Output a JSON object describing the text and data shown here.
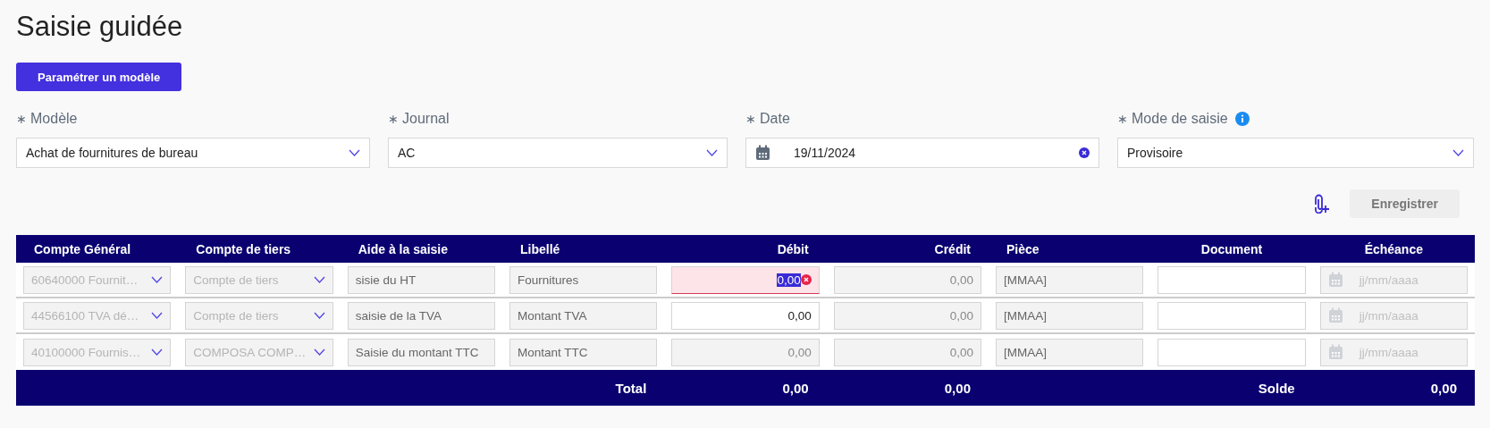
{
  "title": "Saisie guidée",
  "setup_button": "Paramétrer un modèle",
  "fields": [
    {
      "kind": "select",
      "required_mark": "∗",
      "label": "Modèle",
      "value": "Achat de fournitures de bureau"
    },
    {
      "kind": "select",
      "required_mark": "∗",
      "label": "Journal",
      "value": "AC"
    },
    {
      "kind": "date",
      "required_mark": "∗",
      "label": "Date",
      "value": "19/11/2024"
    },
    {
      "kind": "select",
      "required_mark": "∗",
      "label": "Mode de saisie",
      "value": "Provisoire",
      "info": true
    }
  ],
  "save_button": {
    "label": "Enregistrer",
    "disabled": true
  },
  "table": {
    "columns": [
      "Compte Général",
      "Compte de tiers",
      "Aide à la saisie",
      "Libellé",
      "Débit",
      "Crédit",
      "Pièce",
      "Document",
      "Échéance"
    ],
    "rows": [
      {
        "compte_general": "60640000 Fournit…",
        "compte_tiers": {
          "placeholder": "Compte de tiers"
        },
        "aide": "sisie du HT",
        "libelle": "Fournitures",
        "debit": {
          "value": "0,00",
          "disabled": false,
          "error": true,
          "text_selected": true
        },
        "credit": "0,00",
        "piece": "[MMAA]",
        "echeance": {
          "placeholder": "jj/mm/aaaa"
        }
      },
      {
        "compte_general": "44566100 TVA dé…",
        "compte_tiers": {
          "placeholder": "Compte de tiers"
        },
        "aide": "saisie de la TVA",
        "libelle": "Montant TVA",
        "debit": {
          "value": "0,00",
          "disabled": false,
          "error": false,
          "text_selected": false
        },
        "credit": "0,00",
        "piece": "[MMAA]",
        "echeance": {
          "placeholder": "jj/mm/aaaa"
        }
      },
      {
        "compte_general": "40100000 Fournis…",
        "compte_tiers": {
          "value": "COMPOSA COMP…"
        },
        "aide": "Saisie du montant TTC",
        "libelle": "Montant TTC",
        "debit": {
          "value": "0,00",
          "disabled": true,
          "error": false,
          "text_selected": false
        },
        "credit": "0,00",
        "piece": "[MMAA]",
        "echeance": {
          "placeholder": "jj/mm/aaaa"
        }
      }
    ],
    "footer": {
      "total_label": "Total",
      "total_debit": "0,00",
      "total_credit": "0,00",
      "balance_label": "Solde",
      "balance": "0,00"
    }
  }
}
